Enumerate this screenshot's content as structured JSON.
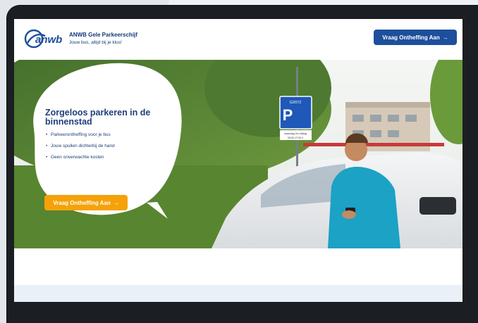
{
  "header": {
    "brand_name": "anwb",
    "title": "ANWB Gele Parkeerschijf",
    "subtitle": "Jouw bus, altijd bij je klus!",
    "cta_label": "Vraag Ontheffing Aan",
    "cta_arrow": "→"
  },
  "hero": {
    "title": "Zorgeloos parkeren in de binnenstad",
    "bullets": [
      "Parkeerontheffing voor je bus",
      "Jouw spullen dichterbij de hand",
      "Geen onverwachte kosten"
    ],
    "bullet_symbol": "•",
    "cta_label": "Vraag Ontheffing Aan",
    "cta_arrow": "→",
    "sign": {
      "number": "G2072",
      "letter": "P",
      "line1": "maandag t/m vrijdag",
      "line2": "09:00-17:00 u"
    }
  },
  "colors": {
    "brand_blue": "#1d4f9c",
    "accent_orange": "#f5a20a",
    "title_blue": "#1d3f7a"
  }
}
